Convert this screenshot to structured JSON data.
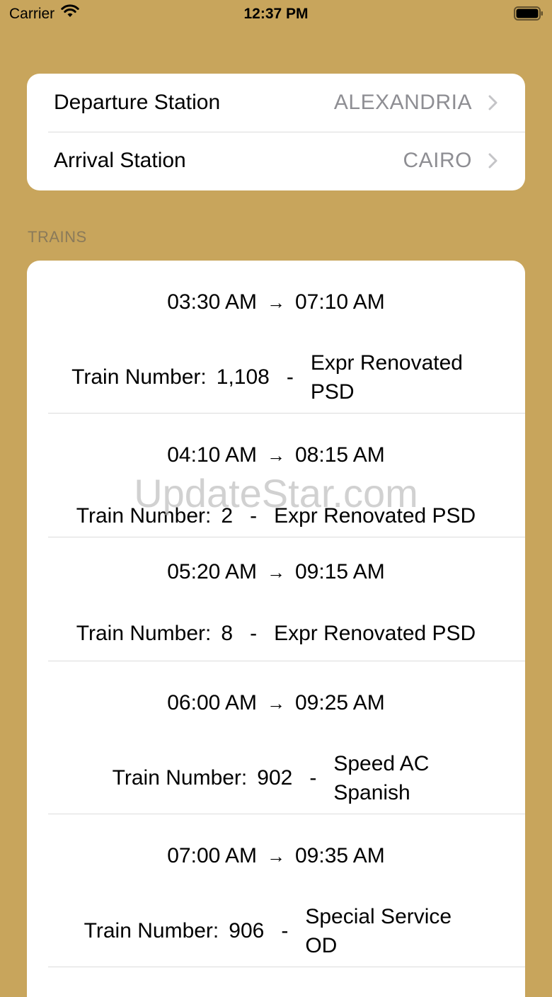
{
  "status_bar": {
    "carrier": "Carrier",
    "time": "12:37 PM"
  },
  "stations": {
    "departure_label": "Departure Station",
    "departure_value": "ALEXANDRIA",
    "arrival_label": "Arrival Station",
    "arrival_value": "CAIRO"
  },
  "section_header": "TRAINS",
  "train_number_label": "Train Number:",
  "trains": [
    {
      "depart": "03:30 AM",
      "arrive": "07:10 AM",
      "number": "1,108",
      "cls_line1": "Expr Renovated",
      "cls_line2": "PSD"
    },
    {
      "depart": "04:10 AM",
      "arrive": "08:15 AM",
      "number": "2",
      "cls_line1": "Expr Renovated PSD",
      "cls_line2": ""
    },
    {
      "depart": "05:20 AM",
      "arrive": "09:15 AM",
      "number": "8",
      "cls_line1": "Expr Renovated PSD",
      "cls_line2": ""
    },
    {
      "depart": "06:00 AM",
      "arrive": "09:25 AM",
      "number": "902",
      "cls_line1": "Speed AC",
      "cls_line2": "Spanish"
    },
    {
      "depart": "07:00 AM",
      "arrive": "09:35 AM",
      "number": "906",
      "cls_line1": "Special Service",
      "cls_line2": "OD"
    }
  ],
  "watermark": "UpdateStar.com",
  "colors": {
    "background": "#c8a55c",
    "card": "#ffffff",
    "secondary_text": "#8e8e93"
  }
}
